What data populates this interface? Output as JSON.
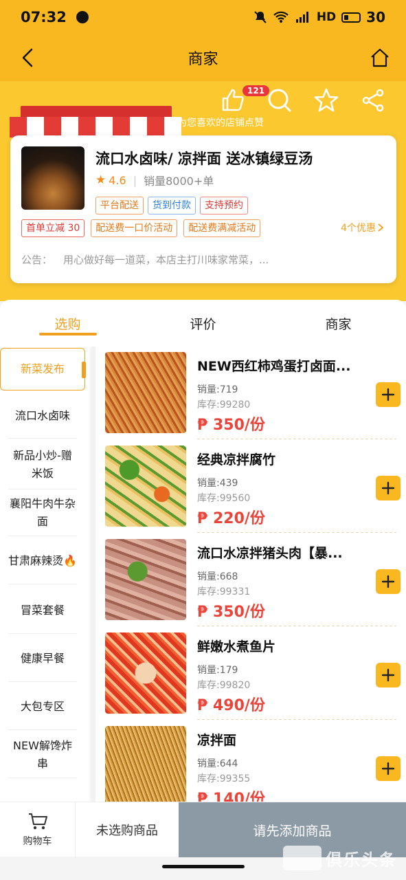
{
  "status_bar": {
    "time": "07:32",
    "network": "HD",
    "battery": "30"
  },
  "nav": {
    "title": "商家"
  },
  "banner": {
    "like_count": "121",
    "hint": "为您喜欢的店铺点赞"
  },
  "shop": {
    "name": "流口水卤味/ 凉拌面 送冰镇绿豆汤",
    "rating": "4.6",
    "sales": "销量8000+单",
    "service_tags": [
      {
        "label": "平台配送",
        "color": "#e07a1a"
      },
      {
        "label": "货到付款",
        "color": "#2a7fd4"
      },
      {
        "label": "支持预约",
        "color": "#d83a36"
      }
    ],
    "promo_tags": [
      "首单立减 30",
      "配送费一口价活动",
      "配送费满减活动"
    ],
    "discount_link": "4个优惠",
    "notice_label": "公告：",
    "notice_text": "用心做好每一道菜，本店主打川味家常菜，..."
  },
  "tabs": [
    {
      "label": "选购",
      "active": true
    },
    {
      "label": "评价",
      "active": false
    },
    {
      "label": "商家",
      "active": false
    }
  ],
  "categories": [
    "新菜发布",
    "流口水卤味",
    "新品小炒-赠米饭",
    "襄阳牛肉牛杂面",
    "甘肃麻辣烫🔥",
    "冒菜套餐",
    "健康早餐",
    "大包专区",
    "NEW解馋炸串"
  ],
  "products": [
    {
      "name": "NEW西红柿鸡蛋打卤面...",
      "sales": "销量:719",
      "stock": "库存:99280",
      "price": "₱ 350/份"
    },
    {
      "name": "经典凉拌腐竹",
      "sales": "销量:439",
      "stock": "库存:99560",
      "price": "₱ 220/份"
    },
    {
      "name": "流口水凉拌猪头肉【暴...",
      "sales": "销量:668",
      "stock": "库存:99331",
      "price": "₱ 350/份"
    },
    {
      "name": "鲜嫩水煮鱼片",
      "sales": "销量:179",
      "stock": "库存:99820",
      "price": "₱ 490/份"
    },
    {
      "name": "凉拌面",
      "sales": "销量:644",
      "stock": "库存:99355",
      "price": "₱ 140/份"
    }
  ],
  "bottom_bar": {
    "cart_label": "购物车",
    "no_items": "未选购商品",
    "checkout": "请先添加商品"
  },
  "watermark": {
    "text": "俱乐头条"
  },
  "colors": {
    "accent": "#f9b81f",
    "price": "#e8463a",
    "active_tab": "#f0a020",
    "checkout_disabled": "#8c9aa5"
  }
}
